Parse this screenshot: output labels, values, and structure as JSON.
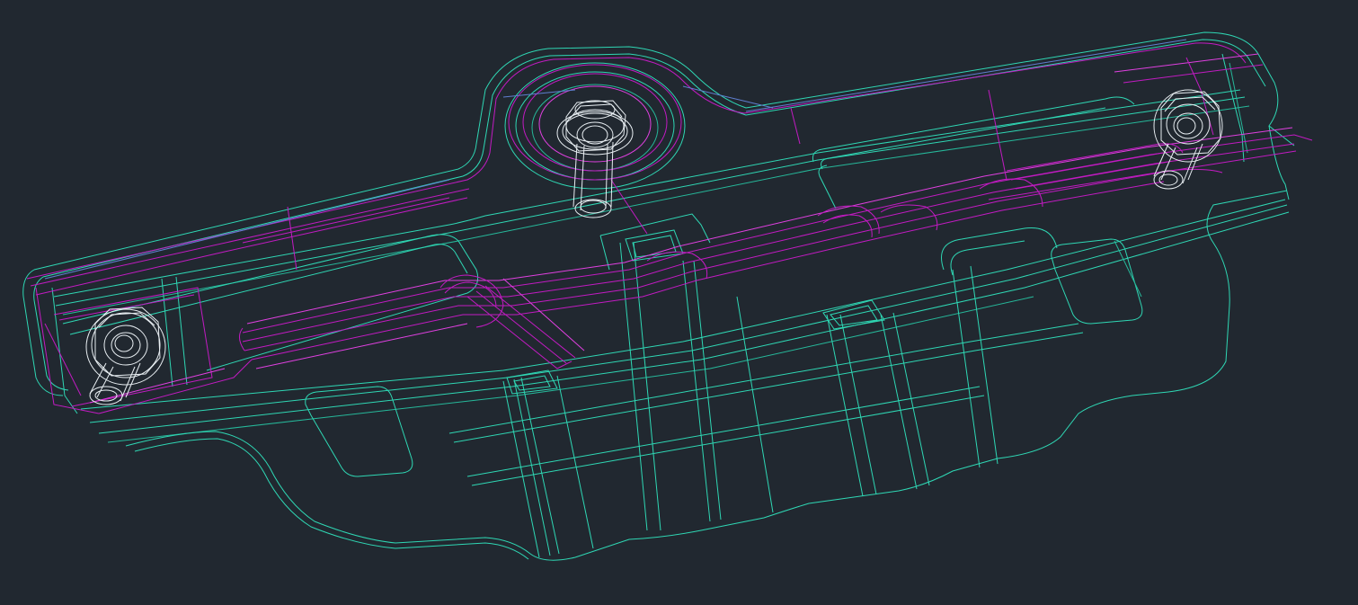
{
  "viewer": {
    "background_color": "#212830",
    "layer_colors": {
      "sheet_metal": "#2fd7b4",
      "bracket": "#c21bc2",
      "fasteners": "#e8eef2"
    }
  },
  "model": {
    "fastener_count": 3
  }
}
